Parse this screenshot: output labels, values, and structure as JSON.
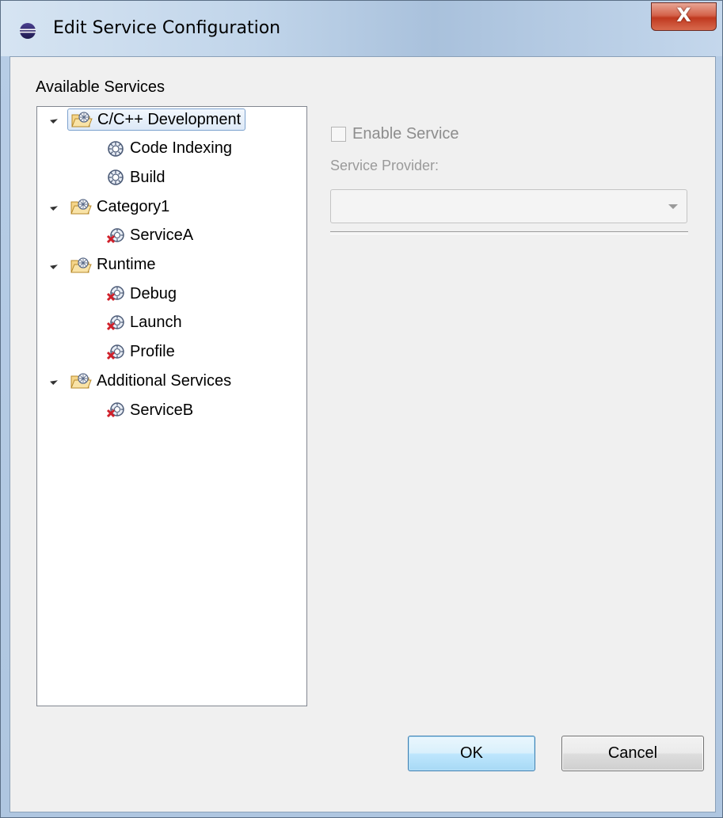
{
  "window": {
    "title": "Edit Service Configuration",
    "close_glyph": "X"
  },
  "tree": {
    "heading": "Available Services",
    "groups": [
      {
        "label": "C/C++ Development",
        "expanded": true,
        "selected": true,
        "icon": "folder-services-icon",
        "children": [
          {
            "label": "Code Indexing",
            "icon": "service-icon",
            "status": "enabled"
          },
          {
            "label": "Build",
            "icon": "service-icon",
            "status": "enabled"
          }
        ]
      },
      {
        "label": "Category1",
        "expanded": true,
        "selected": false,
        "icon": "folder-services-icon",
        "children": [
          {
            "label": "ServiceA",
            "icon": "service-disabled-icon",
            "status": "disabled"
          }
        ]
      },
      {
        "label": "Runtime",
        "expanded": true,
        "selected": false,
        "icon": "folder-services-icon",
        "children": [
          {
            "label": "Debug",
            "icon": "service-disabled-icon",
            "status": "disabled"
          },
          {
            "label": "Launch",
            "icon": "service-disabled-icon",
            "status": "disabled"
          },
          {
            "label": "Profile",
            "icon": "service-disabled-icon",
            "status": "disabled"
          }
        ]
      },
      {
        "label": "Additional Services",
        "expanded": true,
        "selected": false,
        "icon": "folder-services-icon",
        "children": [
          {
            "label": "ServiceB",
            "icon": "service-disabled-icon",
            "status": "disabled"
          }
        ]
      }
    ]
  },
  "details": {
    "enable_label": "Enable Service",
    "enable_checked": false,
    "provider_label": "Service Provider:",
    "provider_value": ""
  },
  "buttons": {
    "ok": "OK",
    "cancel": "Cancel"
  },
  "colors": {
    "selection_border": "#7da2ce",
    "disabled_text": "#8d8d8d",
    "disabled_mark": "#d0202a"
  }
}
